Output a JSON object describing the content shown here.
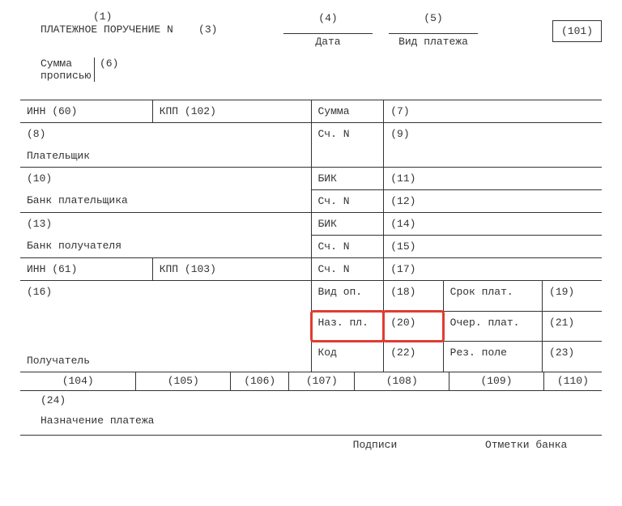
{
  "refTop": "(1)",
  "title": "ПЛАТЕЖНОЕ ПОРУЧЕНИЕ N",
  "titleNum": "(3)",
  "dateNum": "(4)",
  "dateLabel": "Дата",
  "kindNum": "(5)",
  "kindLabel": "Вид платежа",
  "box101": "(101)",
  "sumWord1": "Сумма",
  "sumWord2": "прописью",
  "sumWordNum": "(6)",
  "r1c1": "ИНН (60)",
  "r1c2": "КПП (102)",
  "r1c3": "Сумма",
  "r1c4": "(7)",
  "r2c1": "(8)",
  "r2c3": "Сч. N",
  "r2c4": "(9)",
  "r3c1": "Плательщик",
  "r4c1": "(10)",
  "r4c3": "БИК",
  "r4c4": "(11)",
  "r5c3": "Сч. N",
  "r5c4": "(12)",
  "r6c1": "Банк плательщика",
  "r7c1": "(13)",
  "r7c3": "БИК",
  "r7c4": "(14)",
  "r8c3": "Сч. N",
  "r8c4": "(15)",
  "r9c1": "Банк получателя",
  "r10c1": "ИНН (61)",
  "r10c2": "КПП (103)",
  "r10c3": "Сч. N",
  "r10c4": "(17)",
  "r11c1": "(16)",
  "r12c3": "Вид оп.",
  "r12c4": "(18)",
  "r12c5": "Срок плат.",
  "r12c6": "(19)",
  "r13c3": "Наз. пл.",
  "r13c4": "(20)",
  "r13c5": "Очер. плат.",
  "r13c6": "(21)",
  "r14c1": "Получатель",
  "r14c3": "Код",
  "r14c4": "(22)",
  "r14c5": "Рез. поле",
  "r14c6": "(23)",
  "codes": [
    "(104)",
    "(105)",
    "(106)",
    "(107)",
    "(108)",
    "(109)",
    "(110)"
  ],
  "b24": "(24)",
  "purpose": "Назначение платежа",
  "sig": "Подписи",
  "bank": "Отметки банка"
}
